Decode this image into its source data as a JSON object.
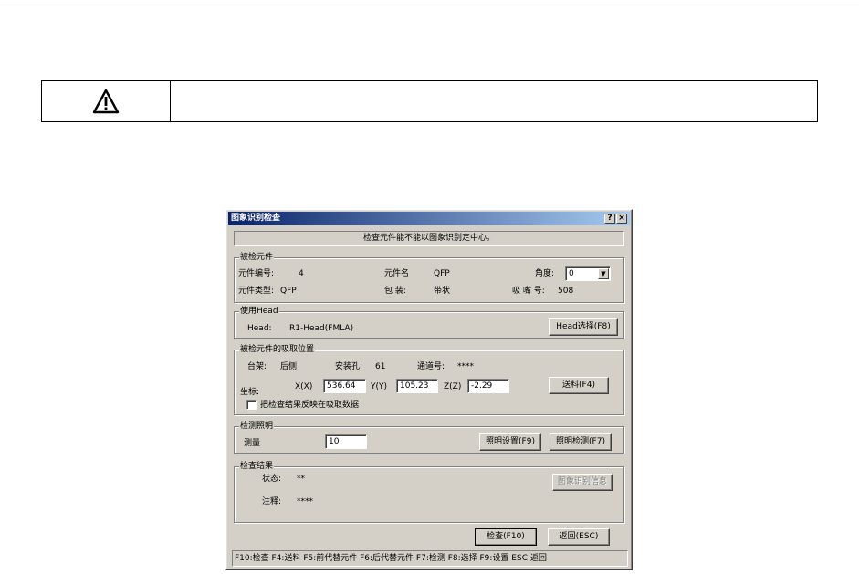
{
  "warning": {
    "icon": "warning-icon",
    "text": ""
  },
  "dialog": {
    "title": "图象识别检查",
    "help_label": "?",
    "close_label": "×",
    "message": "检查元件能不能以图象识别定中心。",
    "inspected_part": {
      "group_title": "被检元件",
      "part_no_label": "元件编号:",
      "part_no_value": "4",
      "part_name_label": "元件名",
      "part_name_value": "QFP",
      "angle_label": "角度:",
      "angle_value": "0",
      "part_type_label": "元件类型:",
      "part_type_value": "QFP",
      "package_label": "包  装:",
      "package_value": "带状",
      "nozzle_label": "吸 嘴 号:",
      "nozzle_value": "508"
    },
    "head": {
      "group_title": "使用Head",
      "head_label": "Head:",
      "head_value": "R1-Head(FMLA)",
      "select_button": "Head选择(F8)"
    },
    "pick_position": {
      "group_title": "被检元件的吸取位置",
      "rack_label": "台架:",
      "rack_value": "后侧",
      "hole_label": "安装孔:",
      "hole_value": "61",
      "lane_label": "通道号:",
      "lane_value": "****",
      "coord_label": "坐标:",
      "x_label": "X(X)",
      "x_value": "536.64",
      "y_label": "Y(Y)",
      "y_value": "105.23",
      "z_label": "Z(Z)",
      "z_value": "-2.29",
      "feed_button": "送料(F4)",
      "reflect_checkbox_label": "把检查结果反映在吸取数据",
      "reflect_checked": false
    },
    "lighting": {
      "group_title": "检测照明",
      "measure_label": "测量",
      "measure_value": "10",
      "light_settings_button": "照明设置(F9)",
      "light_test_button": "照明检测(F7)"
    },
    "result": {
      "group_title": "检查结果",
      "status_label": "状态:",
      "status_value": "**",
      "note_label": "注释:",
      "note_value": "****",
      "image_info_button": "图象识别信息"
    },
    "check_button": "检查(F10)",
    "return_button": "返回(ESC)",
    "status_bar": "F10:检查 F4:送料 F5:前代替元件 F6:后代替元件 F7:检测 F8:选择 F9:设置 ESC:返回"
  }
}
